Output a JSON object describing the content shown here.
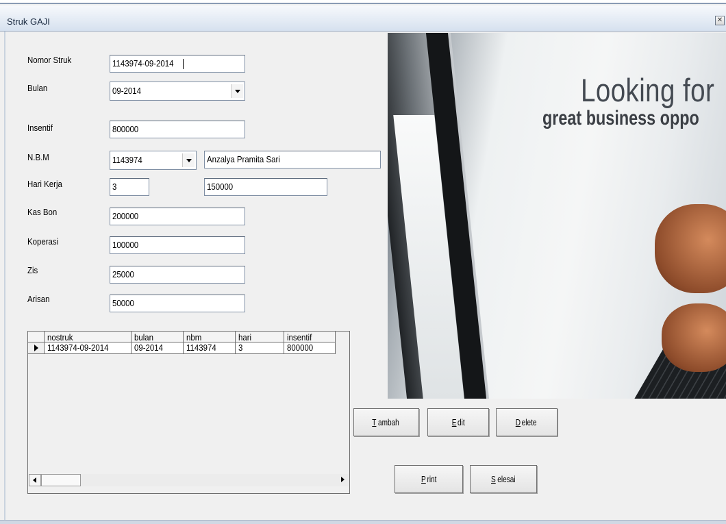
{
  "window": {
    "title": "Struk GAJI",
    "close_icon": "close-icon"
  },
  "form": {
    "nomor_struk": {
      "label": "Nomor Struk",
      "value": "1143974-09-2014"
    },
    "bulan": {
      "label": "Bulan",
      "value": "09-2014"
    },
    "insentif": {
      "label": "Insentif",
      "value": "800000"
    },
    "nbm": {
      "label": "N.B.M",
      "value": "1143974",
      "name_value": "Anzalya Pramita Sari"
    },
    "hari_kerja": {
      "label": "Hari Kerja",
      "value": "3",
      "total_value": "150000"
    },
    "kas_bon": {
      "label": "Kas Bon",
      "value": "200000"
    },
    "koperasi": {
      "label": "Koperasi",
      "value": "100000"
    },
    "zis": {
      "label": "Zis",
      "value": "25000"
    },
    "arisan": {
      "label": "Arisan",
      "value": "50000"
    }
  },
  "banner": {
    "line1": "Looking for",
    "line2": "great business oppo"
  },
  "grid": {
    "columns": [
      "nostruk",
      "bulan",
      "nbm",
      "hari",
      "insentif"
    ],
    "rows": [
      [
        "1143974-09-2014",
        "09-2014",
        "1143974",
        "3",
        "800000"
      ]
    ]
  },
  "buttons": {
    "tambah": {
      "hotkey": "T",
      "rest": "ambah"
    },
    "edit": {
      "hotkey": "E",
      "rest": "dit"
    },
    "delete": {
      "hotkey": "D",
      "rest": "elete"
    },
    "print": {
      "hotkey": "P",
      "rest": "rint"
    },
    "selesai": {
      "hotkey": "S",
      "rest": "elesai"
    }
  }
}
